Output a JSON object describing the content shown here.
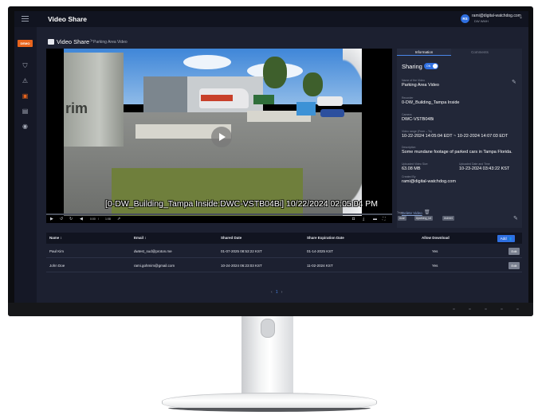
{
  "app": {
    "title": "Video Share"
  },
  "user": {
    "initials": "RS",
    "email": "rami@digital-watchdog.com",
    "role": "DW WMH"
  },
  "sidebar": {
    "demo_badge": "DEMO",
    "items": [
      {
        "icon": "camera-icon",
        "glyph": "⛉"
      },
      {
        "icon": "alert-icon",
        "glyph": "⚠"
      },
      {
        "icon": "video-share-icon",
        "glyph": "▣"
      },
      {
        "icon": "report-icon",
        "glyph": "▤"
      },
      {
        "icon": "user-circle-icon",
        "glyph": "◉"
      }
    ]
  },
  "breadcrumb": {
    "title": "Video Share",
    "separator": ">",
    "current": "Parking Area Video"
  },
  "video": {
    "overlay": "[0-DW_Building_Tampa Inside:DWC-VSTB04Bi] 10/22/2024 02:05:04 PM",
    "trailer_mark": "rim",
    "time_current": "0:00",
    "time_sep": "/",
    "time_total": "1:08"
  },
  "info": {
    "tabs": [
      "Information",
      "Comments"
    ],
    "sharing_label": "Sharing",
    "toggle_text": "ON",
    "fields": [
      {
        "label": "Name of the Video",
        "value": "Parking Area Video"
      },
      {
        "label": "Recorder",
        "value": "0-DW_Building_Tampa Inside"
      },
      {
        "label": "Camera",
        "value": "DWC-VSTB04Bi"
      },
      {
        "label": "Video range (From – To)",
        "value": "10-22-2024 14:05:04 EDT ~ 10-22-2024 14:07:03 EDT"
      },
      {
        "label": "Description",
        "value": "Some mundane footage of parked cars in Tampa Florida."
      }
    ],
    "size_label": "Uploaded Video Size",
    "size_value": "63.08 MB",
    "uploaded_label": "Uploaded Date and Time",
    "uploaded_value": "10-23-2024 03:43:22 KST",
    "created_label": "Created By",
    "created_value": "rami@digital-watchdog.com",
    "delete_label": "Delete Video",
    "tags_label": "Tags",
    "tags": [
      "#car",
      "#parking_lot",
      "#street"
    ]
  },
  "table": {
    "headers": [
      "Name ↕",
      "Email ↕",
      "Shared Date",
      "Share Expiration Date",
      "Allow Download"
    ],
    "add_label": "Add 👥",
    "edit_label": "Edit",
    "rows": [
      {
        "name": "Paul Kim",
        "email": "dwtest_sud@proton.me",
        "shared": "01-07-2025 08:53:22 KST",
        "expires": "01-14-2025 KST",
        "download": "Yes"
      },
      {
        "name": "John Doe",
        "email": "rami.gohmim@gmail.com",
        "shared": "10-24-2024 06:23:03 KST",
        "expires": "11-02-2024 KST",
        "download": "Yes"
      }
    ]
  },
  "pagination": {
    "prev": "‹",
    "current": "1",
    "next": "›"
  }
}
